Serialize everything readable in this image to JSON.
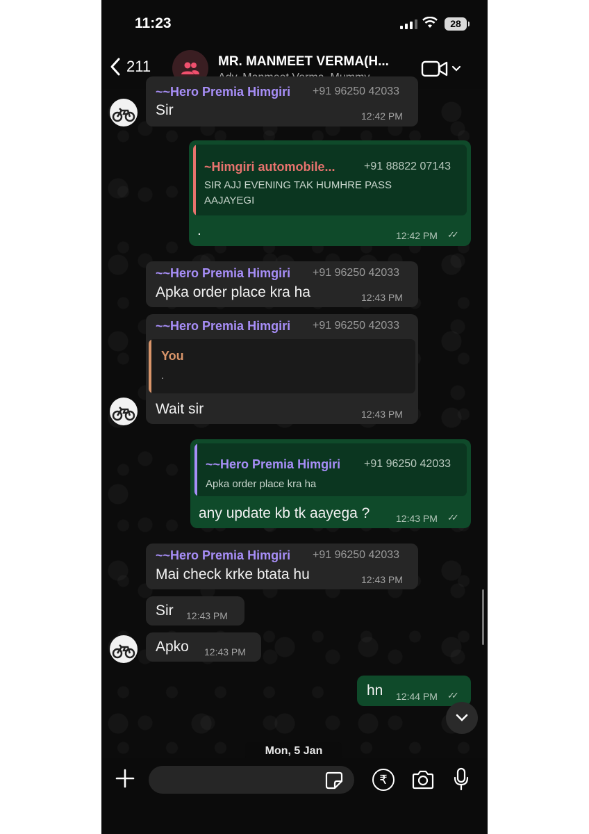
{
  "status_bar": {
    "time": "11:23",
    "battery": "28"
  },
  "header": {
    "back_count": "211",
    "title": "MR. MANMEET VERMA(H...",
    "subtitle": "Adv. Manmeet Verma, Mummy..."
  },
  "messages": [
    {
      "sender": "~~Hero Premia Himgiri",
      "phone": "+91 96250 42033",
      "text": "Sir",
      "time": "12:42 PM"
    },
    {
      "quote_sender": "~Himgiri automobile...",
      "quote_phone": "+91 88822 07143",
      "quote_text_1": "SIR AJJ EVENING TAK HUMHRE PASS",
      "quote_text_2": "AAJAYEGI",
      "text": ".",
      "time": "12:42 PM"
    },
    {
      "sender": "~~Hero Premia Himgiri",
      "phone": "+91 96250 42033",
      "text": "Apka order place kra ha",
      "time": "12:43 PM"
    },
    {
      "sender": "~~Hero Premia Himgiri",
      "phone": "+91 96250 42033",
      "quote_sender": "You",
      "quote_text": ".",
      "text": "Wait sir",
      "time": "12:43 PM"
    },
    {
      "quote_sender": "~~Hero Premia Himgiri",
      "quote_phone": "+91 96250 42033",
      "quote_text": "Apka order place kra ha",
      "text": "any update kb tk aayega ?",
      "time": "12:43 PM"
    },
    {
      "sender": "~~Hero Premia Himgiri",
      "phone": "+91 96250 42033",
      "text": "Mai check krke btata hu",
      "time": "12:43 PM"
    },
    {
      "text": "Sir",
      "time": "12:43 PM"
    },
    {
      "text": "Apko",
      "time": "12:43 PM"
    },
    {
      "text": "hn",
      "time": "12:44 PM"
    }
  ],
  "date_chip": "Mon, 5 Jan",
  "colors": {
    "out_bubble": "#0f4a2a",
    "in_bubble": "#262626",
    "sender_purple": "#a78ef7",
    "quote_red": "#e8736e",
    "quote_you": "#d9956a"
  }
}
